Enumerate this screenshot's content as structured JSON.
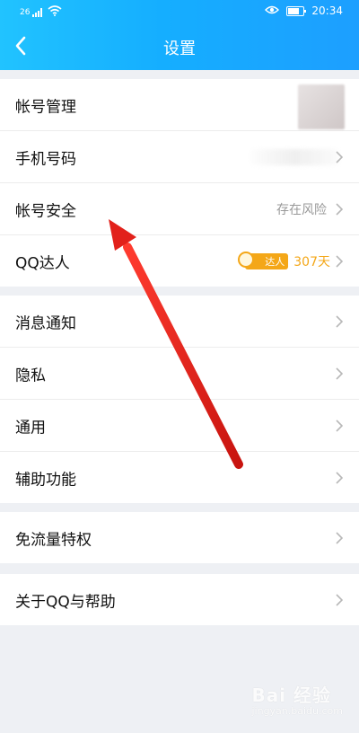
{
  "status_bar": {
    "left_tag": "26",
    "time": "20:34"
  },
  "header": {
    "title": "设置"
  },
  "groups": [
    {
      "items": [
        {
          "label": "帐号管理",
          "value": ""
        },
        {
          "label": "手机号码",
          "value": ""
        },
        {
          "label": "帐号安全",
          "value": "存在风险"
        },
        {
          "label": "QQ达人",
          "badge": "达人",
          "value": "307天"
        }
      ]
    },
    {
      "items": [
        {
          "label": "消息通知"
        },
        {
          "label": "隐私"
        },
        {
          "label": "通用"
        },
        {
          "label": "辅助功能"
        }
      ]
    },
    {
      "items": [
        {
          "label": "免流量特权"
        }
      ]
    },
    {
      "items": [
        {
          "label": "关于QQ与帮助"
        }
      ]
    }
  ],
  "watermark": {
    "text": "Bai 经验",
    "subtext": "jingyan.baidu.com"
  },
  "colors": {
    "header_start": "#21c3ff",
    "header_end": "#1d9fff",
    "accent_orange": "#f4a718",
    "arrow_red": "#e2211b"
  }
}
